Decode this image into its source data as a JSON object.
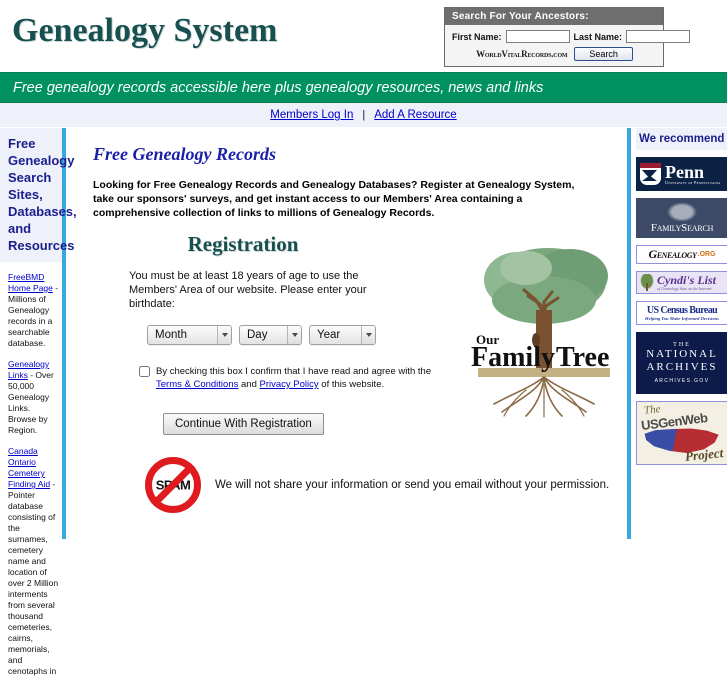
{
  "header": {
    "logo": "Genealogy System",
    "search": {
      "title": "Search For Your Ancestors:",
      "first_name_label": "First Name:",
      "last_name_label": "Last Name:",
      "first_name_value": "",
      "last_name_value": "",
      "provider": "WorldVitalRecords.com",
      "button": "Search"
    }
  },
  "banner": {
    "text": "Free genealogy records accessible here plus genealogy resources, news and links"
  },
  "nav": {
    "members_login": "Members Log In",
    "separator": "|",
    "add_resource": "Add A Resource"
  },
  "sidebar_left": {
    "heading": "Free Genealogy Search Sites, Databases, and Resources",
    "entries": [
      {
        "link": "FreeBMD Home Page",
        "text": " - Millions of Genealogy records in a searchable database."
      },
      {
        "link": "Genealogy Links",
        "text": " - Over 50,000 Genealogy Links. Browse by Region."
      },
      {
        "link": "Canada Ontario Cemetery Finding Aid",
        "text": " - Pointer database consisting of the surnames, cemetery name and location of over 2 Million interments from several thousand cemeteries, cairns, memorials, and cenotaphs in"
      }
    ]
  },
  "main": {
    "title": "Free Genealogy Records",
    "intro": "Looking for Free Genealogy Records and Genealogy Databases? Register at Genealogy System, take our sponsors' surveys, and get instant access to our Members' Area containing a comprehensive collection of links to millions of Genealogy Records.",
    "registration": {
      "title": "Registration",
      "instructions": "You must be at least 18 years of age to use the Members' Area of our website. Please enter your birthdate:",
      "month_select": "Month",
      "day_select": "Day",
      "year_select": "Year",
      "agree_text_1": "By checking this box I confirm that I have read and agree with the ",
      "terms_link": "Terms & Conditions",
      "agree_text_2": " and ",
      "privacy_link": "Privacy Policy",
      "agree_text_3": " of this website.",
      "continue_button": "Continue With Registration"
    },
    "spam_notice": {
      "icon_word": "SPAM",
      "text": "We will not share your information or send you email without your permission."
    },
    "tree_graphic": {
      "line1": "Our",
      "line2": "Family",
      "line3": "Tree"
    }
  },
  "sidebar_right": {
    "heading": "We recommend",
    "badges": [
      {
        "name": "Penn",
        "sub": "University of Pennsylvania"
      },
      {
        "name": "FamilySearch",
        "sub": ""
      },
      {
        "name": "Genealogy",
        "sub": ".ORG"
      },
      {
        "name": "Cyndi's List",
        "sub": "of Genealogy Sites on the Internet"
      },
      {
        "name": "US Census Bureau",
        "sub": "Helping You Make Informed Decisions"
      },
      {
        "name": "The National Archives",
        "the": "THE",
        "main1": "NATIONAL",
        "main2": "ARCHIVES",
        "sub": "ARCHIVES.GOV"
      },
      {
        "name": "The USGenWeb Project",
        "the": "The",
        "main1": "USGenWeb",
        "sub": "Project"
      }
    ]
  },
  "colors": {
    "banner_green": "#009160",
    "logo_teal": "#17504f",
    "link_blue": "#0000cc",
    "divider_blue": "#3aa8e0",
    "heading_navy": "#1a1f8c",
    "spam_red": "#e01b20"
  }
}
